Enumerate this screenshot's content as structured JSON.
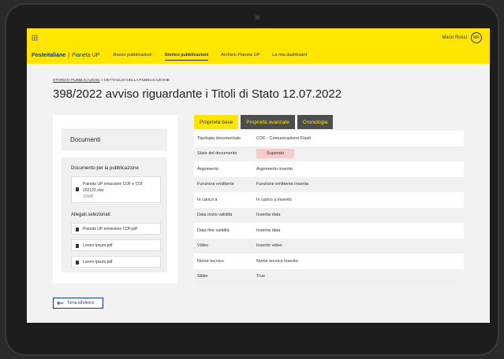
{
  "header": {
    "user_name": "Mario Rossi",
    "user_initials": "MR",
    "brand_name": "Posteitaliane",
    "app_name": "Pianeta UP",
    "nav": [
      {
        "label": "Bozze pubblicazioni",
        "active": false
      },
      {
        "label": "Storico pubblicazioni",
        "active": true
      },
      {
        "label": "Archivio Pianeta UP",
        "active": false
      },
      {
        "label": "La mia dashboard",
        "active": false
      }
    ]
  },
  "breadcrumb": {
    "root": "STORICO PUBBLICAZIONI",
    "separator": " > ",
    "current": "DETTAGLIO DELLA PUBBLICAZIONE"
  },
  "page_title": "398/2022 avviso riguardante i Titoli di Stato 12.07.2022",
  "documents": {
    "title": "Documenti",
    "publication_heading": "Documento per la pubblicazione",
    "main_file": {
      "name_line1": "Pianeta UP emissione COF e COI",
      "name_line2": "202122.xlsx",
      "size": "15MB"
    },
    "attachments_heading": "Allegati selezionati",
    "attachments": [
      "Pianeta UP emissione COF.pdf",
      "Lorem Ipsum.pdf",
      "Lorem Ipsum.pdf"
    ]
  },
  "tabs": [
    {
      "label": "Proprietà base",
      "active": true
    },
    {
      "label": "Proprietà avanzate",
      "active": false
    },
    {
      "label": "Cronologia",
      "active": false
    }
  ],
  "properties": [
    {
      "key": "Tipologia documentale",
      "value": "COF - Comunicazione Flash"
    },
    {
      "key": "Stato del documento",
      "value": "Superato",
      "badge": true
    },
    {
      "key": "Argomento",
      "value": "Argomento inserito"
    },
    {
      "key": "Funzione emittente",
      "value": "Funzione emittente inserita"
    },
    {
      "key": "In carico a",
      "value": "In carico a inserito"
    },
    {
      "key": "Data inizio validità",
      "value": "Inserita data"
    },
    {
      "key": "Data fine validità",
      "value": "Inserita data"
    },
    {
      "key": "Video",
      "value": "Inserito video"
    },
    {
      "key": "Nome tecnico",
      "value": "Nome tecnico inserito"
    },
    {
      "key": "Slider",
      "value": "True"
    }
  ],
  "back_button": "Torna all'elenco",
  "colors": {
    "brand_yellow": "#ffe600",
    "brand_blue": "#0a3d8f",
    "badge_red": "#f5cbcb",
    "tab_dark": "#4d4d4d"
  }
}
